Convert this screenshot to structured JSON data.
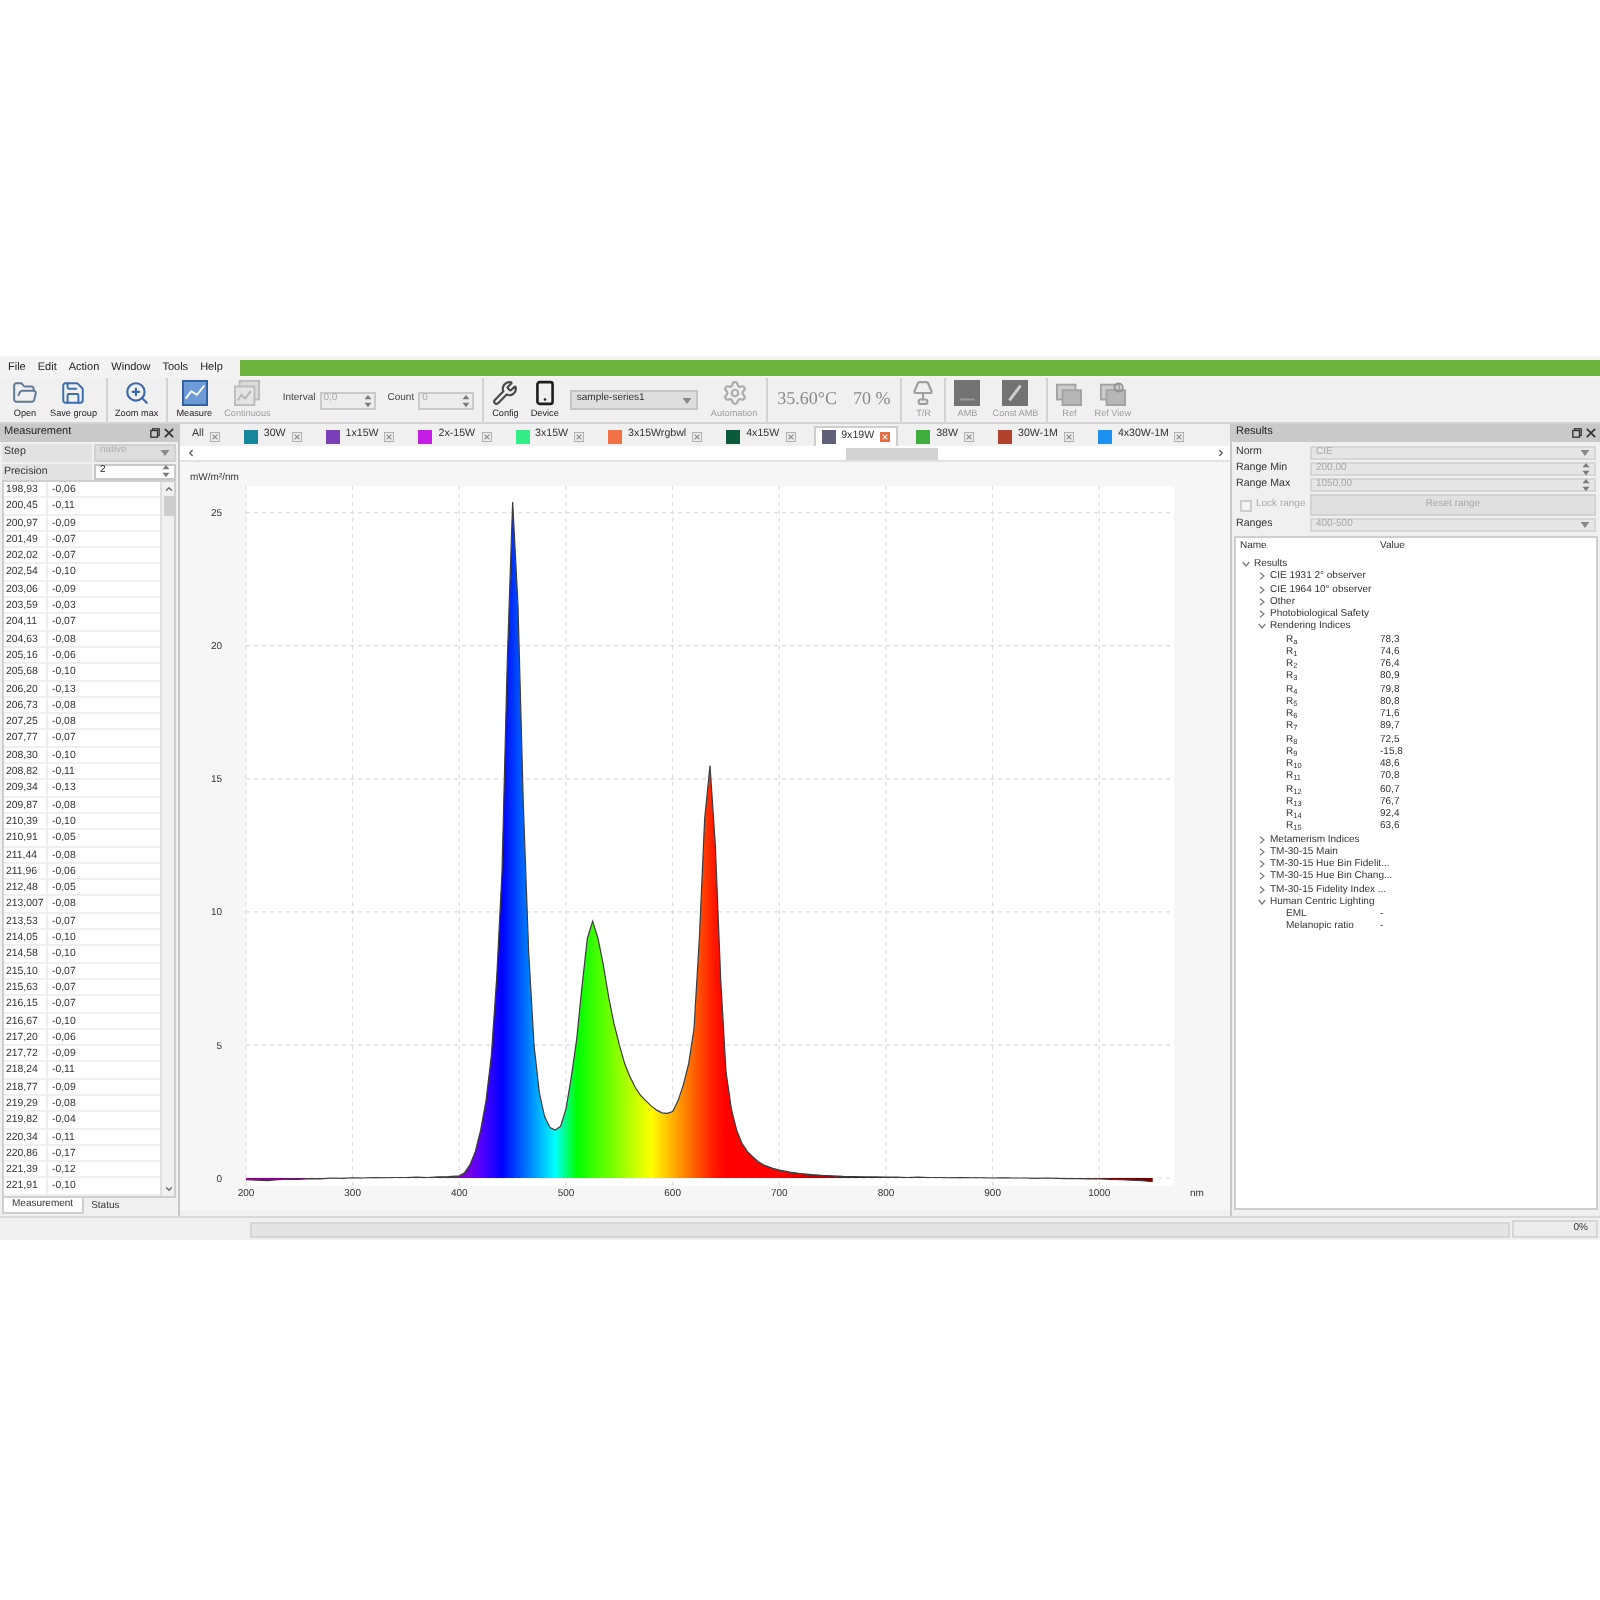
{
  "menu": [
    "File",
    "Edit",
    "Action",
    "Window",
    "Tools",
    "Help"
  ],
  "toolbar": [
    [
      {
        "kind": "button",
        "label": "Open",
        "disabled": false
      },
      {
        "kind": "button",
        "label": "Save group",
        "disabled": false
      }
    ],
    [
      {
        "kind": "button",
        "label": "Zoom max",
        "disabled": false
      }
    ],
    [
      {
        "kind": "button",
        "label": "Measure",
        "disabled": false
      },
      {
        "kind": "button",
        "label": "Continuous",
        "disabled": true
      },
      {
        "kind": "spinner",
        "label": "Interval",
        "value": "0,0",
        "disabled": true
      },
      {
        "kind": "spinner",
        "label": "Count",
        "value": "0",
        "disabled": true
      }
    ],
    [
      {
        "kind": "button",
        "label": "Config",
        "disabled": false
      },
      {
        "kind": "button",
        "label": "Device",
        "disabled": false
      },
      {
        "kind": "dropdown",
        "value": "sample-series1",
        "disabled": false
      },
      {
        "kind": "button",
        "label": "Automation",
        "disabled": true
      }
    ],
    [
      {
        "kind": "readout",
        "value": "35.60°C"
      },
      {
        "kind": "readout",
        "value": "70 %"
      }
    ],
    [
      {
        "kind": "button",
        "label": "T/R",
        "disabled": true
      }
    ],
    [
      {
        "kind": "button",
        "label": "AMB",
        "disabled": true
      },
      {
        "kind": "button",
        "label": "Const AMB",
        "disabled": true
      }
    ],
    [
      {
        "kind": "button",
        "label": "Ref",
        "disabled": true
      },
      {
        "kind": "button",
        "label": "Ref View",
        "disabled": true
      }
    ]
  ],
  "measurement_panel": {
    "title": "Measurement",
    "step": {
      "label": "Step",
      "value": "native",
      "disabled": true
    },
    "precision": {
      "label": "Precision",
      "value": "2"
    },
    "rows": [
      [
        "198,93",
        "-0,06"
      ],
      [
        "200,45",
        "-0,11"
      ],
      [
        "200,97",
        "-0,09"
      ],
      [
        "201,49",
        "-0,07"
      ],
      [
        "202,02",
        "-0,07"
      ],
      [
        "202,54",
        "-0,10"
      ],
      [
        "203,06",
        "-0,09"
      ],
      [
        "203,59",
        "-0,03"
      ],
      [
        "204,11",
        "-0,07"
      ],
      [
        "204,63",
        "-0,08"
      ],
      [
        "205,16",
        "-0,06"
      ],
      [
        "205,68",
        "-0,10"
      ],
      [
        "206,20",
        "-0,13"
      ],
      [
        "206,73",
        "-0,08"
      ],
      [
        "207,25",
        "-0,08"
      ],
      [
        "207,77",
        "-0,07"
      ],
      [
        "208,30",
        "-0,10"
      ],
      [
        "208,82",
        "-0,11"
      ],
      [
        "209,34",
        "-0,13"
      ],
      [
        "209,87",
        "-0,08"
      ],
      [
        "210,39",
        "-0,10"
      ],
      [
        "210,91",
        "-0,05"
      ],
      [
        "211,44",
        "-0,08"
      ],
      [
        "211,96",
        "-0,06"
      ],
      [
        "212,48",
        "-0,05"
      ],
      [
        "213,007",
        "-0,08"
      ],
      [
        "213,53",
        "-0,07"
      ],
      [
        "214,05",
        "-0,10"
      ],
      [
        "214,58",
        "-0,10"
      ],
      [
        "215,10",
        "-0,07"
      ],
      [
        "215,63",
        "-0,07"
      ],
      [
        "216,15",
        "-0,07"
      ],
      [
        "216,67",
        "-0,10"
      ],
      [
        "217,20",
        "-0,06"
      ],
      [
        "217,72",
        "-0,09"
      ],
      [
        "218,24",
        "-0,11"
      ],
      [
        "218,77",
        "-0,09"
      ],
      [
        "219,29",
        "-0,08"
      ],
      [
        "219,82",
        "-0,04"
      ],
      [
        "220,34",
        "-0,11"
      ],
      [
        "220,86",
        "-0,17"
      ],
      [
        "221,39",
        "-0,12"
      ],
      [
        "221,91",
        "-0,10"
      ]
    ],
    "tabs": [
      {
        "label": "Measurement",
        "selected": true
      },
      {
        "label": "Status",
        "selected": false
      }
    ]
  },
  "spectrum_tabs": [
    {
      "label": "All",
      "selected": false
    },
    {
      "label": "30W",
      "color": "#16879a",
      "selected": false
    },
    {
      "label": "1x15W",
      "color": "#7a3fb6",
      "selected": false
    },
    {
      "label": "2x-15W",
      "color": "#c41ee6",
      "selected": false
    },
    {
      "label": "3x15W",
      "color": "#33ee88",
      "selected": false
    },
    {
      "label": "3x15Wrgbwl",
      "color": "#f07244",
      "selected": false
    },
    {
      "label": "4x15W",
      "color": "#0b5a3c",
      "selected": false
    },
    {
      "label": "9x19W",
      "color": "#5f6078",
      "selected": true
    },
    {
      "label": "38W",
      "color": "#3fae3f",
      "selected": false
    },
    {
      "label": "30W-1M",
      "color": "#b0422e",
      "selected": false
    },
    {
      "label": "4x30W-1M",
      "color": "#1e90f2",
      "selected": false
    }
  ],
  "chart": {
    "chart_data": {
      "type": "area",
      "grid": true,
      "xlabel": "nm",
      "ylabel": "mW/m²/nm",
      "xlim": [
        200,
        1070
      ],
      "ylim": [
        -0.3,
        26
      ],
      "xticks": [
        200,
        300,
        400,
        500,
        600,
        700,
        800,
        900,
        1000
      ],
      "yticks": [
        0,
        5,
        10,
        15,
        20,
        25
      ],
      "x": [
        200,
        210,
        220,
        230,
        240,
        250,
        260,
        270,
        280,
        290,
        300,
        310,
        320,
        330,
        340,
        350,
        360,
        370,
        380,
        390,
        400,
        405,
        410,
        415,
        420,
        425,
        430,
        435,
        440,
        445,
        450,
        455,
        460,
        465,
        470,
        475,
        480,
        485,
        490,
        495,
        500,
        505,
        510,
        515,
        520,
        525,
        530,
        535,
        540,
        545,
        550,
        555,
        560,
        565,
        570,
        575,
        580,
        585,
        590,
        595,
        600,
        605,
        610,
        615,
        620,
        625,
        630,
        635,
        640,
        645,
        650,
        655,
        660,
        665,
        670,
        675,
        680,
        685,
        690,
        695,
        700,
        710,
        720,
        730,
        740,
        750,
        760,
        770,
        780,
        790,
        800,
        810,
        820,
        830,
        840,
        850,
        860,
        870,
        880,
        890,
        900,
        910,
        920,
        930,
        940,
        950,
        960,
        970,
        980,
        990,
        1000,
        1010,
        1020,
        1030,
        1040,
        1050
      ],
      "series": [
        {
          "color": "#3c3c3c",
          "values": [
            -0.06,
            -0.08,
            -0.1,
            -0.06,
            -0.04,
            -0.05,
            -0.02,
            -0.03,
            0.0,
            -0.01,
            0.01,
            0.0,
            0.02,
            0.01,
            0.02,
            0.02,
            0.03,
            0.02,
            0.04,
            0.05,
            0.08,
            0.2,
            0.5,
            1.0,
            1.8,
            2.9,
            4.6,
            7.5,
            11.5,
            19.5,
            25.4,
            21.5,
            14.0,
            8.5,
            5.0,
            3.2,
            2.3,
            1.9,
            1.8,
            1.95,
            2.6,
            3.8,
            5.2,
            7.2,
            9.0,
            9.65,
            9.0,
            8.0,
            6.8,
            5.8,
            5.0,
            4.3,
            3.8,
            3.4,
            3.1,
            2.9,
            2.7,
            2.55,
            2.45,
            2.43,
            2.5,
            2.9,
            3.5,
            4.3,
            5.6,
            9.0,
            13.5,
            15.5,
            12.5,
            7.5,
            4.0,
            2.6,
            1.8,
            1.3,
            1.0,
            0.8,
            0.62,
            0.5,
            0.42,
            0.35,
            0.3,
            0.22,
            0.17,
            0.13,
            0.1,
            0.08,
            0.06,
            0.05,
            0.04,
            0.04,
            0.03,
            0.03,
            0.02,
            0.03,
            0.02,
            0.02,
            0.01,
            0.02,
            0.01,
            0.01,
            0.0,
            0.01,
            0.0,
            0.0,
            -0.01,
            0.0,
            -0.01,
            -0.02,
            -0.02,
            -0.03,
            -0.03,
            -0.05,
            -0.06,
            -0.08,
            -0.1,
            -0.14
          ]
        }
      ]
    }
  },
  "results_panel": {
    "title": "Results",
    "fields": [
      {
        "kind": "dropdown",
        "label": "Norm",
        "value": "CIE",
        "disabled": true
      },
      {
        "kind": "spinner",
        "label": "Range Min",
        "value": "200,00",
        "disabled": true
      },
      {
        "kind": "spinner",
        "label": "Range Max",
        "value": "1050,00",
        "disabled": true
      },
      {
        "kind": "checkbox",
        "label": "Lock range",
        "checked": false,
        "disabled": true
      },
      {
        "kind": "button",
        "label": "Reset range",
        "disabled": true
      },
      {
        "kind": "dropdown",
        "label": "Ranges",
        "value": "400-500",
        "disabled": true
      }
    ],
    "tree": {
      "columns": [
        "Name",
        "Value"
      ],
      "items": [
        {
          "name": "Results",
          "expanded": true,
          "children": [
            {
              "name": "CIE 1931 2° observer",
              "expanded": false
            },
            {
              "name": "CIE 1964 10° observer",
              "expanded": false
            },
            {
              "name": "Other",
              "expanded": false
            },
            {
              "name": "Photobiological Safety",
              "expanded": false
            },
            {
              "name": "Rendering Indices",
              "expanded": true,
              "children": [
                {
                  "name": "R$_{a}$",
                  "value": "78,3"
                },
                {
                  "name": "R$_{1}$",
                  "value": "74,6"
                },
                {
                  "name": "R$_{2}$",
                  "value": "76,4"
                },
                {
                  "name": "R$_{3}$",
                  "value": "80,9"
                },
                {
                  "name": "R$_{4}$",
                  "value": "79,8"
                },
                {
                  "name": "R$_{5}$",
                  "value": "80,8"
                },
                {
                  "name": "R$_{6}$",
                  "value": "71,6"
                },
                {
                  "name": "R$_{7}$",
                  "value": "89,7"
                },
                {
                  "name": "R$_{8}$",
                  "value": "72,5"
                },
                {
                  "name": "R$_{9}$",
                  "value": "-15,8"
                },
                {
                  "name": "R$_{10}$",
                  "value": "48,6"
                },
                {
                  "name": "R$_{11}$",
                  "value": "70,8"
                },
                {
                  "name": "R$_{12}$",
                  "value": "60,7"
                },
                {
                  "name": "R$_{13}$",
                  "value": "76,7"
                },
                {
                  "name": "R$_{14}$",
                  "value": "92,4"
                },
                {
                  "name": "R$_{15}$",
                  "value": "63,6"
                }
              ]
            },
            {
              "name": "Metamerism Indices",
              "expanded": false
            },
            {
              "name": "TM-30-15 Main",
              "expanded": false
            },
            {
              "name": "TM-30-15 Hue Bin Fidelit...",
              "expanded": false
            },
            {
              "name": "TM-30-15 Hue Bin Chang...",
              "expanded": false
            },
            {
              "name": "TM-30-15 Fidelity Index ...",
              "expanded": false
            },
            {
              "name": "Human Centric Lighting",
              "expanded": true,
              "children": [
                {
                  "name": "EML",
                  "value": "-"
                },
                {
                  "name": "Melanopic ratio",
                  "value": "-"
                }
              ]
            }
          ]
        }
      ]
    }
  },
  "status_bar": {
    "progress": {
      "level": 0,
      "text": "0%"
    }
  }
}
